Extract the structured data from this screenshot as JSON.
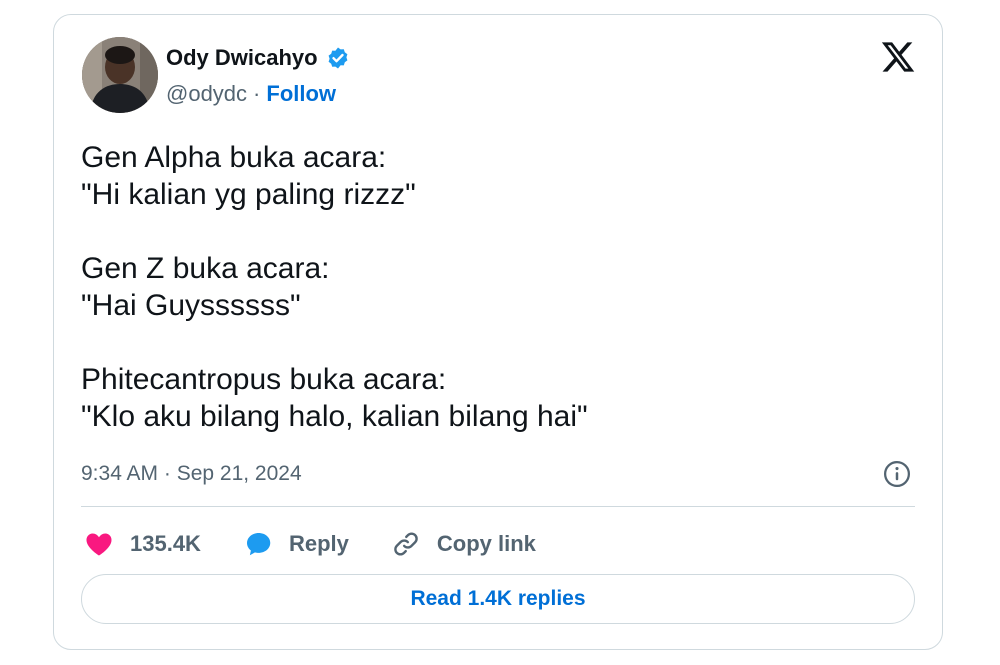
{
  "author": {
    "name": "Ody Dwicahyo",
    "handle": "@odydc",
    "separator": "·",
    "follow_label": "Follow",
    "verified_color": "#1d9bf0"
  },
  "tweet": {
    "lines": [
      "Gen Alpha buka acara:",
      "\"Hi kalian yg paling rizzz\"",
      "",
      "Gen Z buka acara:",
      "\"Hai Guyssssss\"",
      "",
      "Phitecantropus buka acara:",
      "\"Klo aku bilang halo, kalian bilang hai\""
    ],
    "timestamp": "9:34 AM · Sep 21, 2024"
  },
  "actions": {
    "like_count": "135.4K",
    "reply_label": "Reply",
    "copy_link_label": "Copy link",
    "like_color": "#f91880",
    "reply_color": "#1d9bf0"
  },
  "read_replies_label": "Read 1.4K replies",
  "icons": {
    "brand": "x-logo-icon",
    "info": "info-icon",
    "like": "heart-icon",
    "reply": "speech-bubble-icon",
    "copy": "link-icon",
    "verified": "verified-badge-icon"
  }
}
